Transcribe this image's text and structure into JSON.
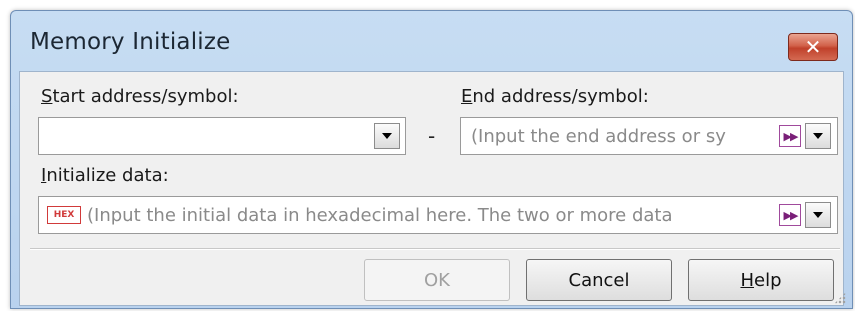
{
  "window": {
    "title": "Memory Initialize",
    "close_label": "✕"
  },
  "start": {
    "label_key": "S",
    "label_rest": "tart address/symbol:",
    "value": ""
  },
  "end": {
    "label_key": "E",
    "label_rest": "nd address/symbol:",
    "placeholder": "(Input the end address or sy"
  },
  "separator_dash": "-",
  "init_data": {
    "label_key": "I",
    "label_rest": "nitialize data:",
    "hex_badge": "HEX",
    "placeholder": "(Input the initial data in hexadecimal here. The two or more data"
  },
  "buttons": {
    "ok": "OK",
    "cancel": "Cancel",
    "help_key": "H",
    "help_rest": "elp"
  },
  "icons": {
    "close": "close-icon",
    "dropdown": "chevron-down-icon",
    "fast_forward": "fast-forward-icon",
    "hex": "hex-icon",
    "resize": "resize-grip-icon"
  }
}
